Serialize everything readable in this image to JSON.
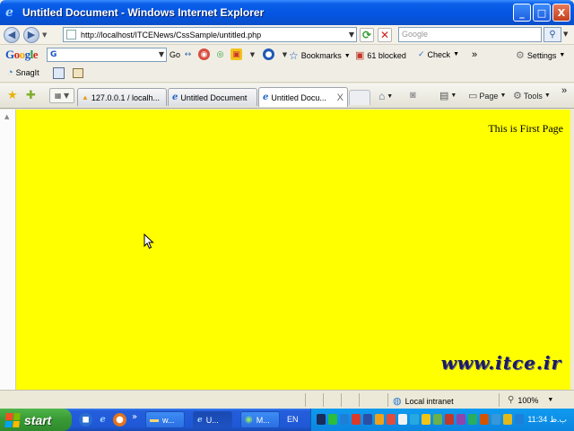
{
  "window": {
    "title": "Untitled Document - Windows Internet Explorer",
    "minimize_glyph": "_",
    "maximize_glyph": "□",
    "close_glyph": "X"
  },
  "addressbar": {
    "url": "http://localhost/ITCENews/CssSample/untitled.php",
    "search_placeholder": "Google"
  },
  "google_toolbar": {
    "logo": [
      "G",
      "o",
      "o",
      "g",
      "l",
      "e"
    ],
    "search_value": "G",
    "go_label": "Go",
    "bookmarks_label": "Bookmarks",
    "blocked_label": "61 blocked",
    "check_label": "Check",
    "more_glyph": "»",
    "settings_label": "Settings"
  },
  "snagit": {
    "label": "SnagIt"
  },
  "tabs": [
    {
      "label": "127.0.0.1 / localh...",
      "active": false
    },
    {
      "label": "Untitled Document",
      "active": false
    },
    {
      "label": "Untitled Docu...",
      "active": true
    }
  ],
  "tab_close_glyph": "X",
  "command_bar": {
    "page_label": "Page",
    "tools_label": "Tools",
    "more_glyph": "»"
  },
  "content": {
    "heading": "This is First Page",
    "watermark": "www.itce.ir"
  },
  "statusbar": {
    "zone": "Local intranet",
    "zoom": "100%"
  },
  "taskbar": {
    "start_label": "start",
    "tasks": [
      {
        "label": "w..."
      },
      {
        "label": "U..."
      },
      {
        "label": "M..."
      }
    ],
    "language": "EN",
    "clock": "11:34 ب.ظ"
  },
  "colors": {
    "page_background": "#ffff00",
    "titlebar": "#0454e1",
    "taskbar": "#245edb",
    "start_button": "#3a9b36"
  }
}
